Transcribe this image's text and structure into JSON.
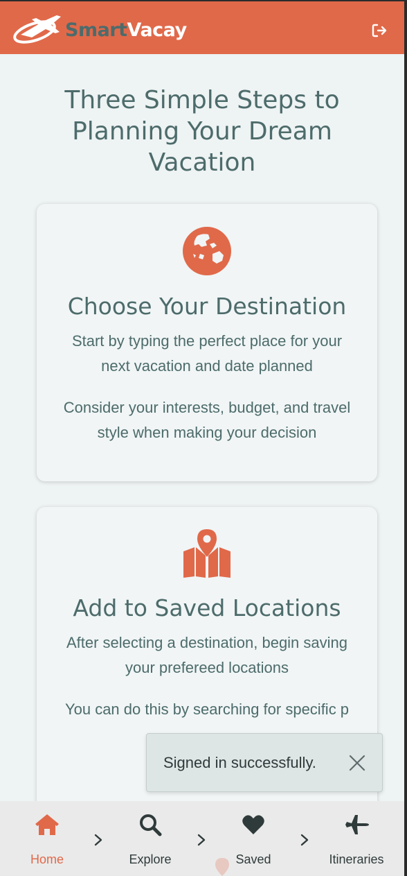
{
  "header": {
    "logo_part1": "Smart",
    "logo_part2": "Vacay",
    "logout_icon": "sign-out-icon"
  },
  "main": {
    "heading": "Three Simple Steps to Planning Your Dream Vacation",
    "steps": [
      {
        "icon": "globe-icon",
        "title": "Choose Your Destination",
        "text1": "Start by typing the perfect place for your next vacation and date planned",
        "text2": "Consider your interests, budget, and travel style when making your decision"
      },
      {
        "icon": "map-location-icon",
        "title": "Add to Saved Locations",
        "text1": "After selecting a destination, begin saving your prefereed locations",
        "text2": "You can do this by searching for specific p"
      }
    ]
  },
  "toast": {
    "message": "Signed in successfully.",
    "close_icon": "close-icon"
  },
  "bottom_nav": {
    "items": [
      {
        "label": "Home",
        "icon": "home-icon",
        "active": true
      },
      {
        "label": "Explore",
        "icon": "search-icon"
      },
      {
        "label": "Saved",
        "icon": "heart-icon"
      },
      {
        "label": "Itineraries",
        "icon": "plane-icon"
      }
    ]
  },
  "colors": {
    "brand": "#e0694a",
    "text": "#4d6b6b",
    "background": "#eef3f3"
  }
}
